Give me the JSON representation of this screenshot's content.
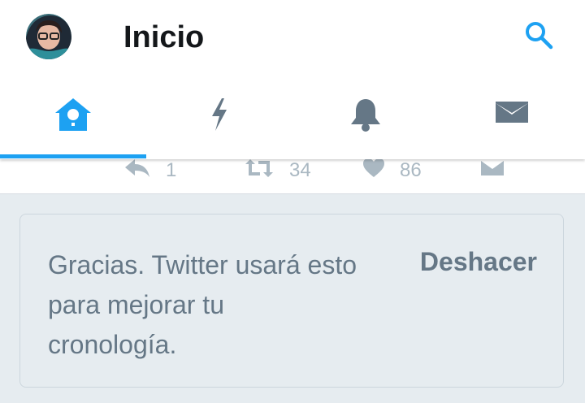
{
  "header": {
    "title": "Inicio",
    "accent_color": "#1da1f2",
    "avatar_icon": "user-avatar",
    "search_icon": "search-icon"
  },
  "tabs": [
    {
      "name": "home",
      "icon": "home-birdhouse-icon",
      "active": true
    },
    {
      "name": "moments",
      "icon": "lightning-icon",
      "active": false
    },
    {
      "name": "notifications",
      "icon": "bell-icon",
      "active": false
    },
    {
      "name": "messages",
      "icon": "envelope-icon",
      "active": false
    }
  ],
  "tweet_actions": {
    "reply_count": "1",
    "retweet_count": "34",
    "like_count": "86"
  },
  "notice": {
    "text": "Gracias. Twitter usará esto para mejorar tu cronología.",
    "undo_label": "Deshacer"
  }
}
